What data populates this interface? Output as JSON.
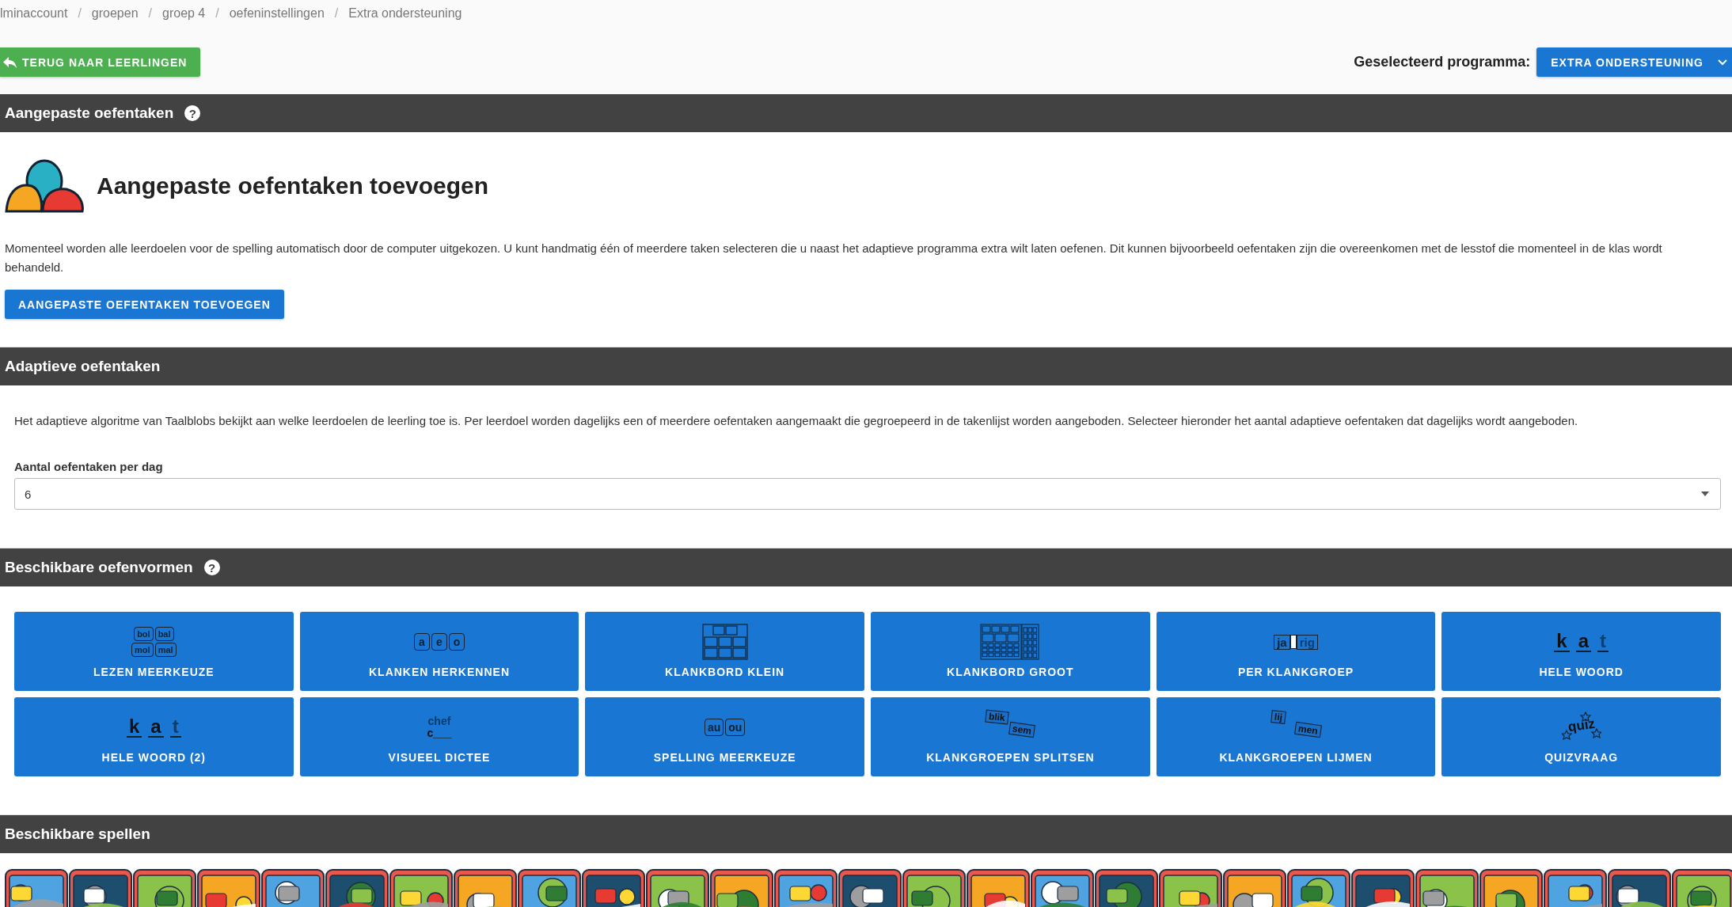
{
  "breadcrumb": [
    {
      "label": "lminaccount"
    },
    {
      "separator": "/",
      "label": "groepen"
    },
    {
      "separator": "/",
      "label": "groep 4"
    },
    {
      "separator": "/",
      "label": "oefeninstellingen"
    },
    {
      "separator": "/",
      "label": "Extra ondersteuning"
    }
  ],
  "back_button": "TERUG NAAR LEERLINGEN",
  "program": {
    "label": "Geselecteerd programma:",
    "value": "EXTRA ONDERSTEUNING"
  },
  "custom_tasks": {
    "header": "Aangepaste oefentaken",
    "help": "?",
    "title": "Aangepaste oefentaken toevoegen",
    "text": "Momenteel worden alle leerdoelen voor de spelling automatisch door de computer uitgekozen. U kunt handmatig één of meerdere taken selecteren die u naast het adaptieve programma extra wilt laten oefenen. Dit kunnen bijvoorbeeld oefentaken zijn die overeenkomen met de lesstof die momenteel in de klas wordt behandeld.",
    "button": "AANGEPASTE OEFENTAKEN TOEVOEGEN"
  },
  "adaptive": {
    "header": "Adaptieve oefentaken",
    "text": "Het adaptieve algoritme van Taalblobs bekijkt aan welke leerdoelen de leerling toe is. Per leerdoel worden dagelijks een of meerdere oefentaken aangemaakt die gegroepeerd in de takenlijst worden aangeboden. Selecteer hieronder het aantal adaptieve oefentaken dat dagelijks wordt aangeboden.",
    "field_label": "Aantal oefentaken per dag",
    "field_value": "6"
  },
  "exercise_forms": {
    "header": "Beschikbare oefenvormen",
    "help": "?",
    "tiles": [
      {
        "label": "LEZEN MEERKEUZE",
        "kind": "boxes",
        "words": [
          "bol",
          "bal",
          "mol",
          "mal"
        ]
      },
      {
        "label": "KLANKEN HERKENNEN",
        "kind": "boxes",
        "words": [
          "a",
          "e",
          "o"
        ]
      },
      {
        "label": "KLANKBORD KLEIN",
        "kind": "board-small"
      },
      {
        "label": "KLANKBORD GROOT",
        "kind": "board-large"
      },
      {
        "label": "PER KLANKGROEP",
        "kind": "joined",
        "words": [
          "ja",
          "rig"
        ]
      },
      {
        "label": "HELE WOORD",
        "kind": "underlined",
        "words": [
          "k",
          "a",
          "t"
        ]
      },
      {
        "label": "HELE WOORD (2)",
        "kind": "underlined",
        "words": [
          "k",
          "a",
          "t"
        ]
      },
      {
        "label": "VISUEEL DICTEE",
        "kind": "dictee",
        "words": [
          "chef",
          "c___"
        ]
      },
      {
        "label": "SPELLING MEERKEUZE",
        "kind": "boxes",
        "words": [
          "au",
          "ou"
        ]
      },
      {
        "label": "KLANKGROEPEN SPLITSEN",
        "kind": "tilted",
        "words": [
          "blik",
          "sem"
        ]
      },
      {
        "label": "KLANKGROEPEN LIJMEN",
        "kind": "tilted",
        "words": [
          "lij",
          "men"
        ]
      },
      {
        "label": "QUIZVRAAG",
        "kind": "quiz",
        "words": [
          "quiz"
        ]
      }
    ]
  },
  "games": {
    "header": "Beschikbare spellen"
  }
}
